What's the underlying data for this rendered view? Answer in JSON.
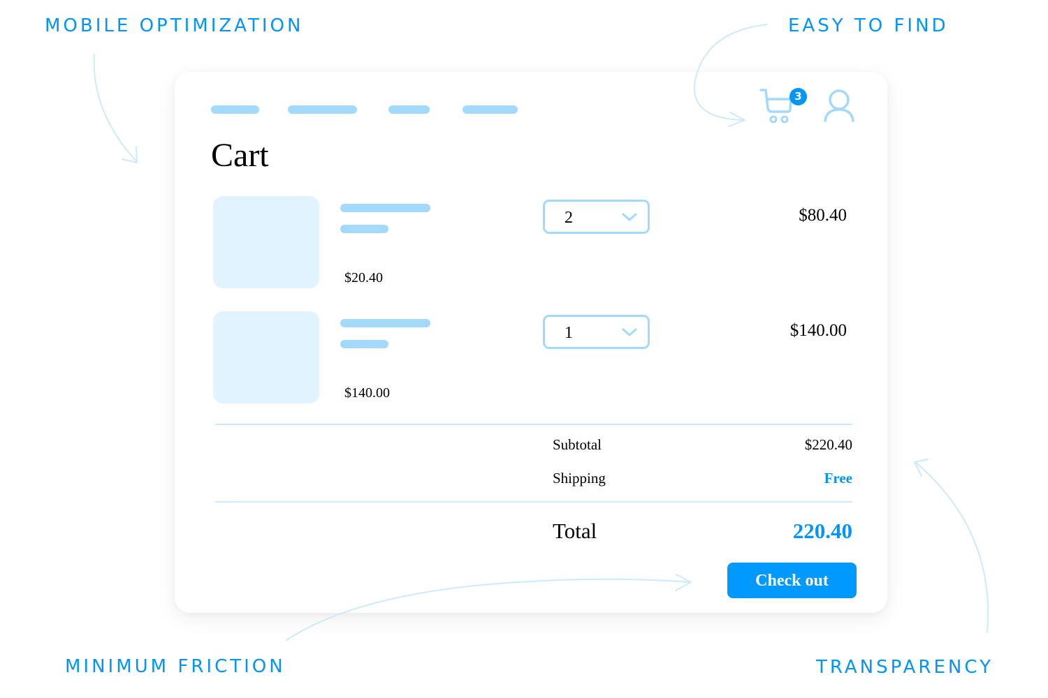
{
  "annotations": {
    "top_left": "MOBILE OPTIMIZATION",
    "top_right": "EASY TO FIND",
    "bottom_left": "MINIMUM FRICTION",
    "bottom_right": "TRANSPARENCY"
  },
  "colors": {
    "accent": "#0095f6",
    "placeholder_light": "#a3d9fc",
    "thumbnail_bg": "#e1f3fe",
    "arrow": "#cdeafd"
  },
  "header": {
    "nav_placeholders": 4,
    "cart_icon": "shopping-cart-icon",
    "cart_badge_count": "3",
    "user_icon": "user-icon"
  },
  "cart": {
    "title": "Cart",
    "items": [
      {
        "unit_price": "$20.40",
        "quantity": "2",
        "line_total": "$80.40"
      },
      {
        "unit_price": "$140.00",
        "quantity": "1",
        "line_total": "$140.00"
      }
    ],
    "summary": {
      "subtotal_label": "Subtotal",
      "subtotal_value": "$220.40",
      "shipping_label": "Shipping",
      "shipping_value": "Free",
      "total_label": "Total",
      "total_value": "220.40"
    },
    "checkout_label": "Check out"
  }
}
